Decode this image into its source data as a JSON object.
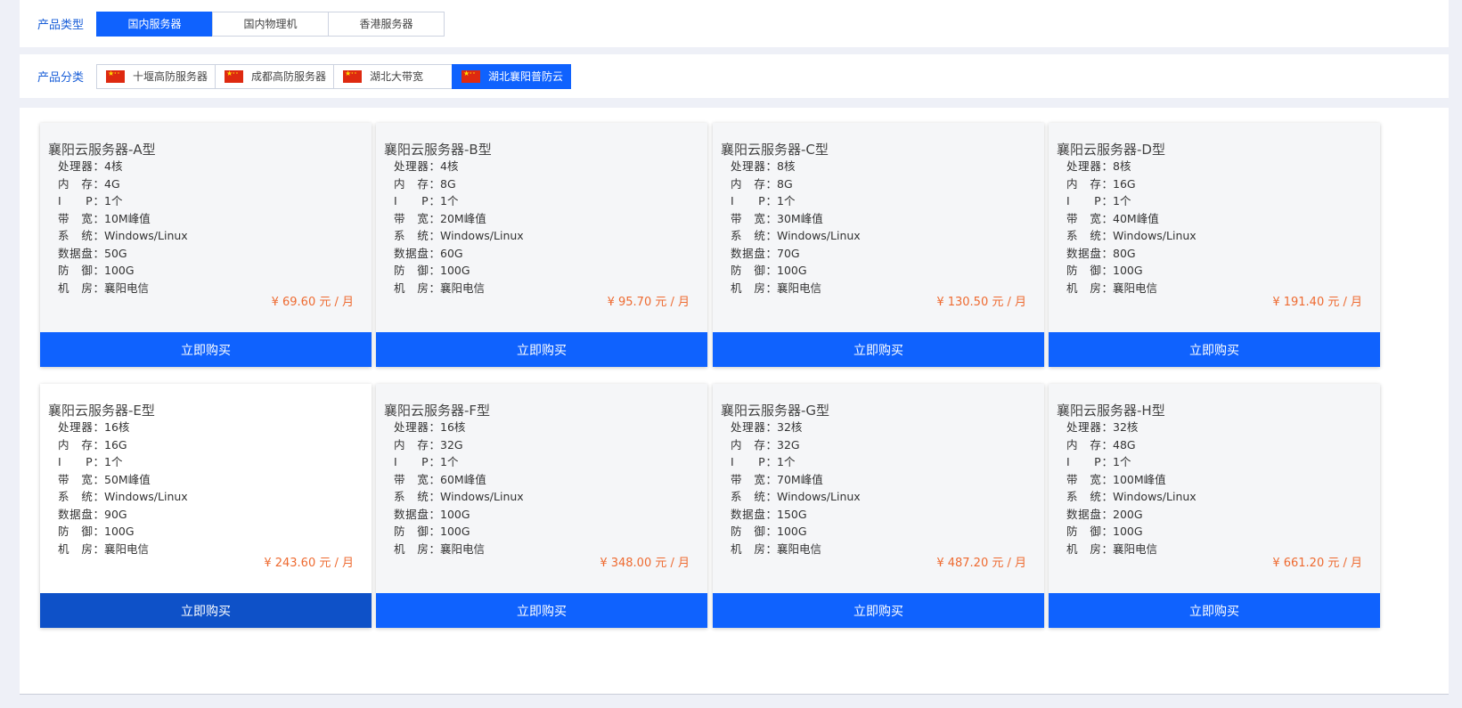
{
  "filters": {
    "type_label": "产品类型",
    "types": [
      {
        "label": "国内服务器",
        "active": true
      },
      {
        "label": "国内物理机",
        "active": false
      },
      {
        "label": "香港服务器",
        "active": false
      }
    ],
    "category_label": "产品分类",
    "categories": [
      {
        "label": "十堰高防服务器",
        "active": false,
        "icon": "cn-flag-icon"
      },
      {
        "label": "成都高防服务器",
        "active": false,
        "icon": "cn-flag-icon"
      },
      {
        "label": "湖北大带宽",
        "active": false,
        "icon": "cn-flag-icon"
      },
      {
        "label": "湖北襄阳普防云",
        "active": true,
        "icon": "cn-flag-icon"
      }
    ]
  },
  "spec_labels": [
    "处理器：",
    "内　存：",
    "I　　P：",
    "带　宽：",
    "系　统：",
    "数据盘：",
    "防　御：",
    "机　房："
  ],
  "buy_label": "立即购买",
  "products": [
    {
      "title": "襄阳云服务器-A型",
      "specs": [
        "4核",
        "4G",
        "1个",
        "10M峰值",
        "Windows/Linux",
        "50G",
        "100G",
        "襄阳电信"
      ],
      "price": "¥ 69.60 元 / 月"
    },
    {
      "title": "襄阳云服务器-B型",
      "specs": [
        "4核",
        "8G",
        "1个",
        "20M峰值",
        "Windows/Linux",
        "60G",
        "100G",
        "襄阳电信"
      ],
      "price": "¥ 95.70 元 / 月"
    },
    {
      "title": "襄阳云服务器-C型",
      "specs": [
        "8核",
        "8G",
        "1个",
        "30M峰值",
        "Windows/Linux",
        "70G",
        "100G",
        "襄阳电信"
      ],
      "price": "¥ 130.50 元 / 月"
    },
    {
      "title": "襄阳云服务器-D型",
      "specs": [
        "8核",
        "16G",
        "1个",
        "40M峰值",
        "Windows/Linux",
        "80G",
        "100G",
        "襄阳电信"
      ],
      "price": "¥ 191.40 元 / 月"
    },
    {
      "title": "襄阳云服务器-E型",
      "specs": [
        "16核",
        "16G",
        "1个",
        "50M峰值",
        "Windows/Linux",
        "90G",
        "100G",
        "襄阳电信"
      ],
      "price": "¥ 243.60 元 / 月"
    },
    {
      "title": "襄阳云服务器-F型",
      "specs": [
        "16核",
        "32G",
        "1个",
        "60M峰值",
        "Windows/Linux",
        "100G",
        "100G",
        "襄阳电信"
      ],
      "price": "¥ 348.00 元 / 月"
    },
    {
      "title": "襄阳云服务器-G型",
      "specs": [
        "32核",
        "32G",
        "1个",
        "70M峰值",
        "Windows/Linux",
        "150G",
        "100G",
        "襄阳电信"
      ],
      "price": "¥ 487.20 元 / 月"
    },
    {
      "title": "襄阳云服务器-H型",
      "specs": [
        "32核",
        "48G",
        "1个",
        "100M峰值",
        "Windows/Linux",
        "200G",
        "100G",
        "襄阳电信"
      ],
      "price": "¥ 661.20 元 / 月"
    }
  ],
  "colors": {
    "accent": "#0f62fe",
    "accent_pressed": "#0e51c8",
    "price": "#ee6a30",
    "label": "#1a5fd8"
  }
}
